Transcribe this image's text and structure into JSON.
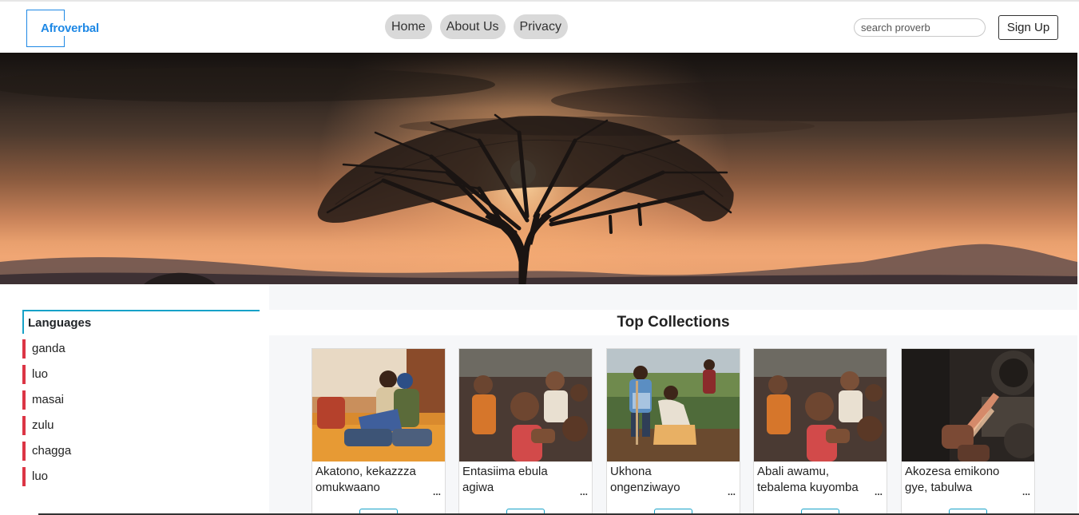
{
  "brand": {
    "name": "Afroverbal"
  },
  "nav": {
    "items": [
      {
        "label": "Home"
      },
      {
        "label": "About Us"
      },
      {
        "label": "Privacy"
      }
    ]
  },
  "search": {
    "placeholder": "search proverb",
    "value": ""
  },
  "auth": {
    "signup_label": "Sign Up"
  },
  "sidebar": {
    "title": "Languages",
    "items": [
      {
        "label": "ganda"
      },
      {
        "label": "luo"
      },
      {
        "label": "masai"
      },
      {
        "label": "zulu"
      },
      {
        "label": "chagga"
      },
      {
        "label": "luo"
      }
    ]
  },
  "collections": {
    "title": "Top Collections",
    "more": "...",
    "cards": [
      {
        "caption": "Akatono, kekazzza omukwaano"
      },
      {
        "caption": "Entasiima ebula agiwa"
      },
      {
        "caption": "Ukhona ongenziwayo"
      },
      {
        "caption": "Abali awamu, tebalema kuyomba"
      },
      {
        "caption": "Akozesa emikono gye, tabulwa ky'ookya"
      }
    ]
  },
  "colors": {
    "accent": "#17a2c8",
    "brand": "#1e88e5",
    "language_marker": "#dc3545"
  }
}
